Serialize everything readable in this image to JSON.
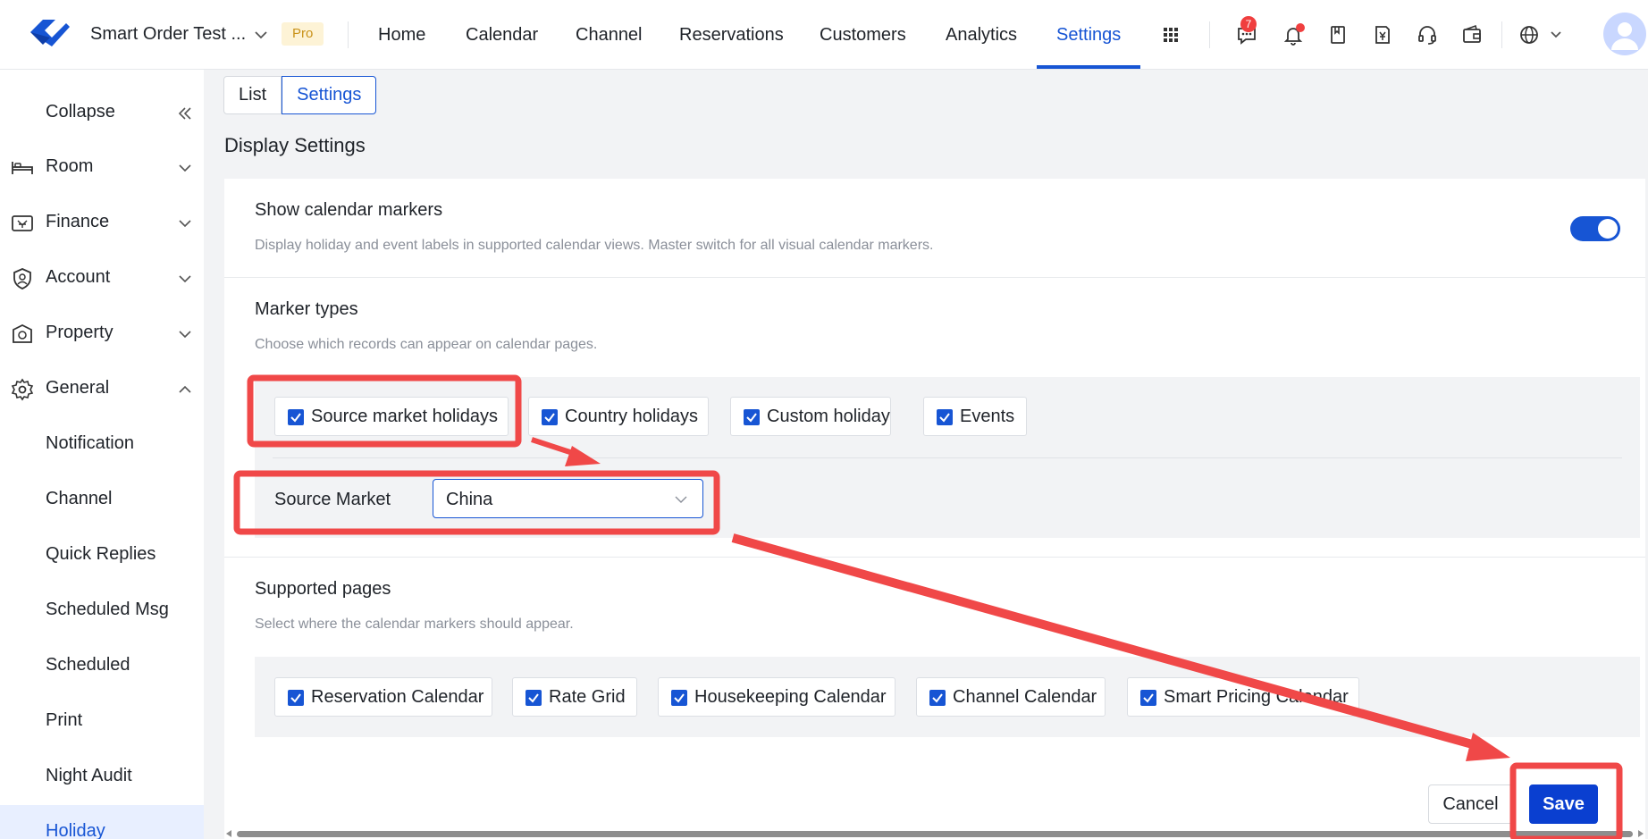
{
  "header": {
    "app_name": "Smart Order Test ...",
    "plan_badge": "Pro",
    "nav": [
      {
        "label": "Home"
      },
      {
        "label": "Calendar"
      },
      {
        "label": "Channel"
      },
      {
        "label": "Reservations"
      },
      {
        "label": "Customers"
      },
      {
        "label": "Analytics"
      },
      {
        "label": "Settings",
        "active": true
      }
    ],
    "message_badge_count": "7",
    "icons": [
      "apps-grid-icon",
      "message-icon",
      "bell-icon",
      "bookmark-icon",
      "invoice-yen-icon",
      "headset-icon",
      "wallet-icon",
      "globe-icon",
      "avatar"
    ]
  },
  "sidebar": {
    "collapse_label": "Collapse",
    "items": [
      {
        "label": "Room",
        "icon": "bed-icon"
      },
      {
        "label": "Finance",
        "icon": "cash-register-icon"
      },
      {
        "label": "Account",
        "icon": "user-shield-icon"
      },
      {
        "label": "Property",
        "icon": "property-icon"
      },
      {
        "label": "General",
        "icon": "gear-icon",
        "expanded": true
      }
    ],
    "sub_items": [
      {
        "label": "Notification"
      },
      {
        "label": "Channel"
      },
      {
        "label": "Quick Replies"
      },
      {
        "label": "Scheduled Msg"
      },
      {
        "label": "Scheduled"
      },
      {
        "label": "Print"
      },
      {
        "label": "Night Audit"
      },
      {
        "label": "Holiday",
        "active": true
      }
    ]
  },
  "tabs": [
    {
      "label": "List"
    },
    {
      "label": "Settings",
      "active": true
    }
  ],
  "page_heading": "Display Settings",
  "calendar_markers": {
    "title": "Show calendar markers",
    "description": "Display holiday and event labels in supported calendar views. Master switch for all visual calendar markers.",
    "enabled": true
  },
  "marker_types": {
    "title": "Marker types",
    "description": "Choose which records can appear on calendar pages.",
    "options": [
      {
        "label": "Source market holidays",
        "checked": true
      },
      {
        "label": "Country holidays",
        "checked": true
      },
      {
        "label": "Custom holiday",
        "checked": true
      },
      {
        "label": "Events",
        "checked": true
      }
    ],
    "source_market_label": "Source Market",
    "source_market_value": "China"
  },
  "supported_pages": {
    "title": "Supported pages",
    "description": "Select where the calendar markers should appear.",
    "options": [
      {
        "label": "Reservation Calendar",
        "checked": true
      },
      {
        "label": "Rate Grid",
        "checked": true
      },
      {
        "label": "Housekeeping Calendar",
        "checked": true
      },
      {
        "label": "Channel Calendar",
        "checked": true
      },
      {
        "label": "Smart Pricing Calendar",
        "checked": true
      }
    ]
  },
  "footer": {
    "cancel_label": "Cancel",
    "save_label": "Save"
  },
  "colors": {
    "accent": "#1755d4",
    "save_button": "#0a3fd0",
    "annotation": "#f04848",
    "pro_badge_bg": "#fdf3d6",
    "pro_badge_text": "#c9921a"
  }
}
